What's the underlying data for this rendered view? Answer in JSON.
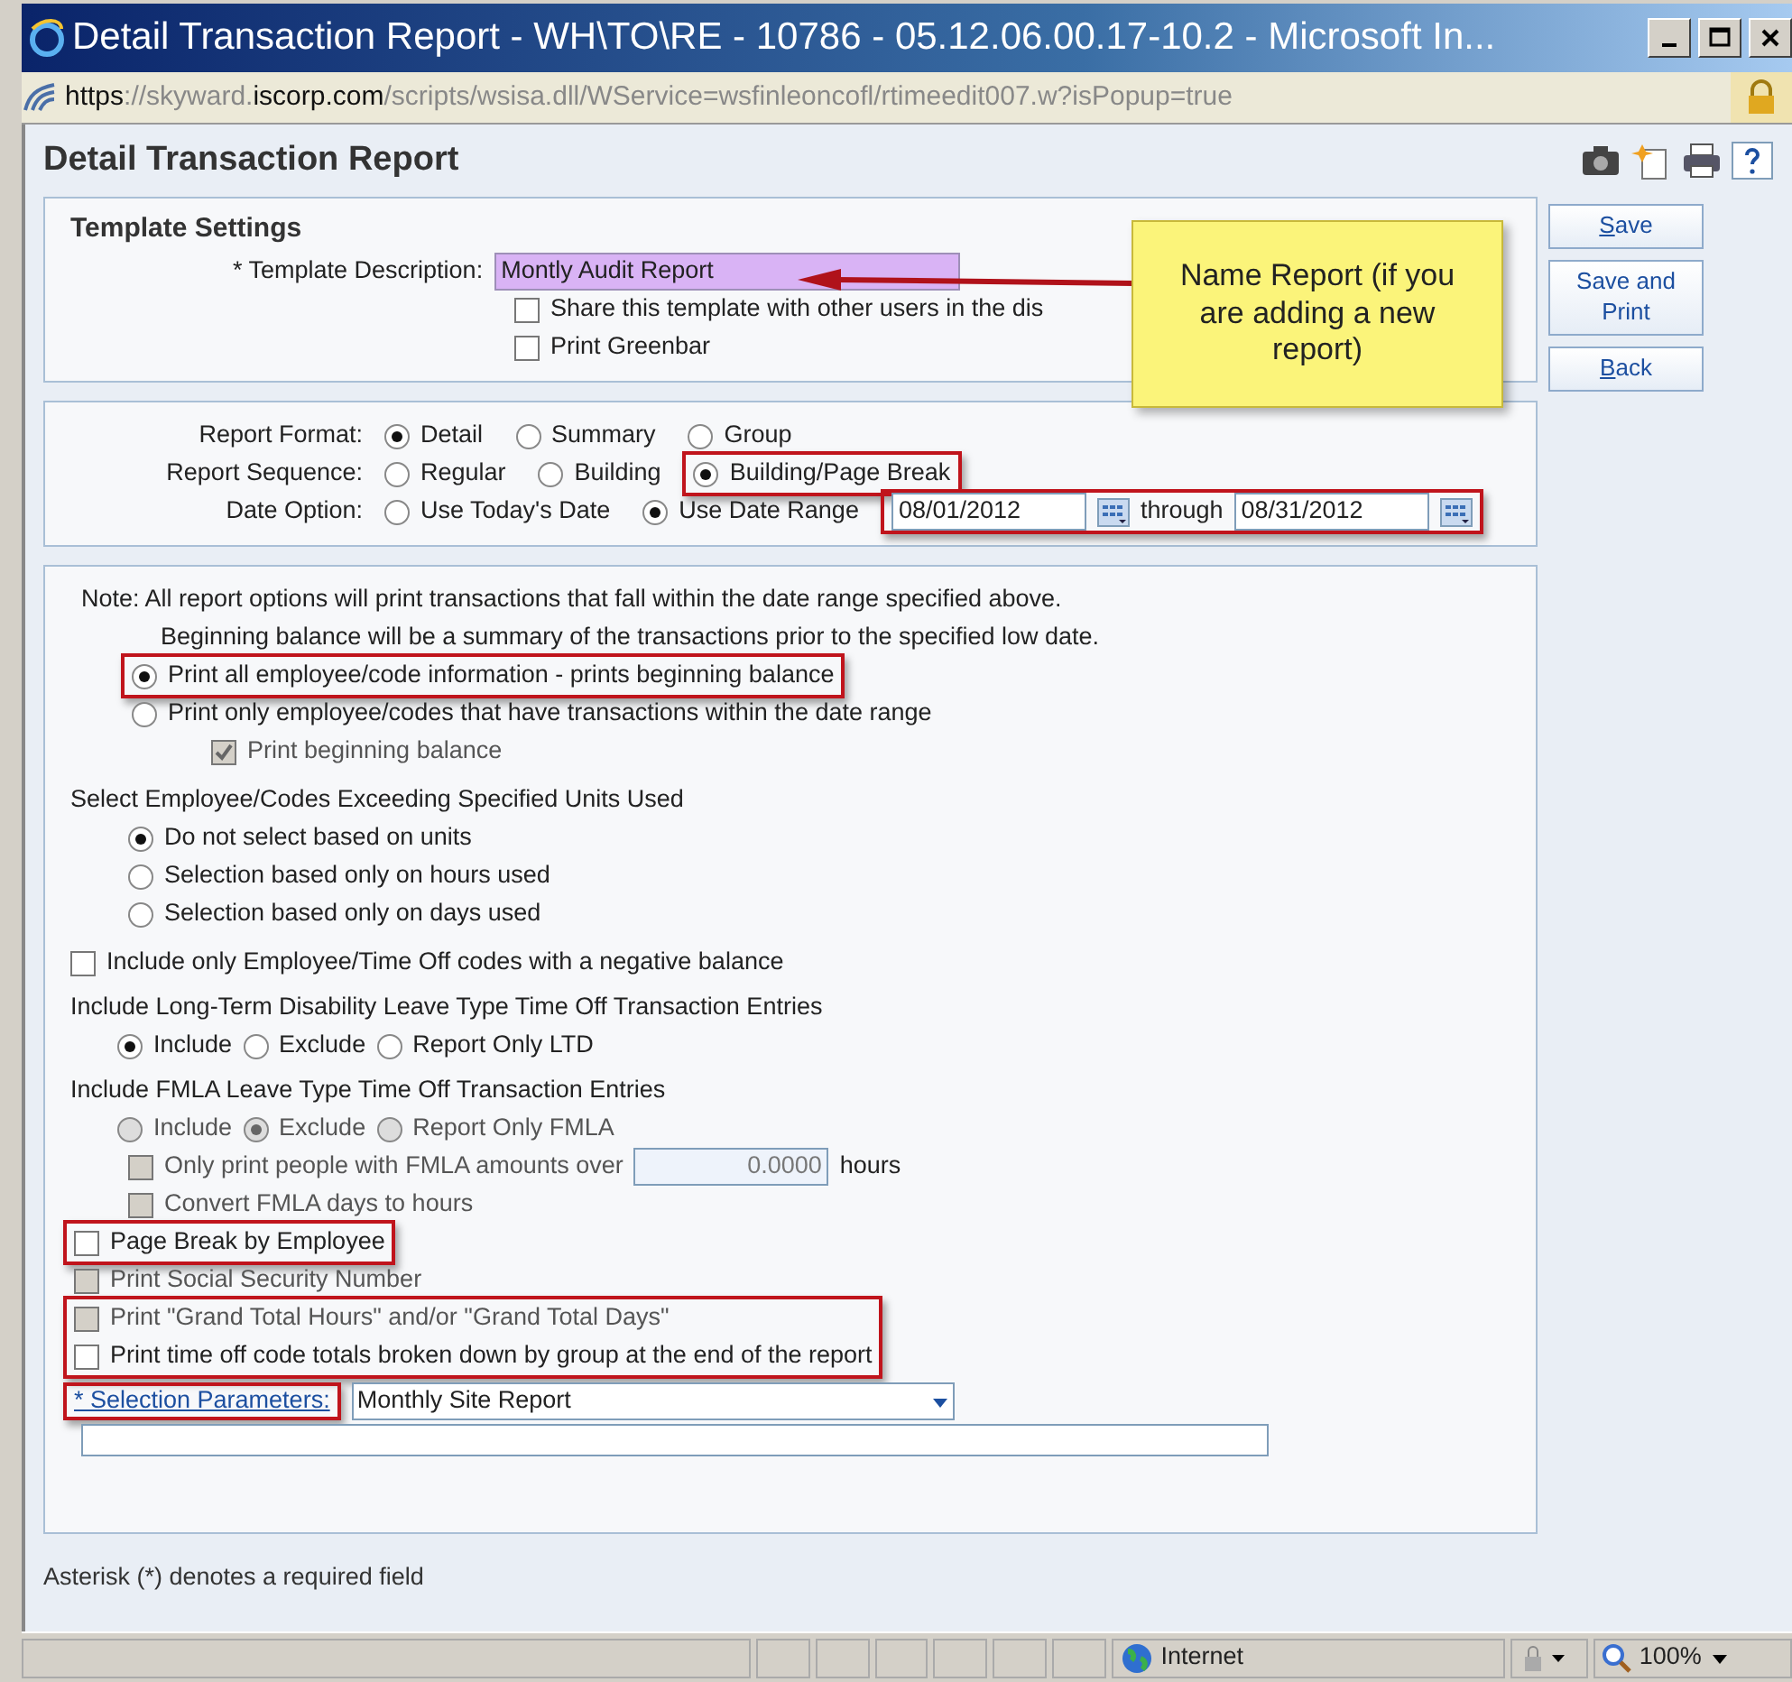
{
  "window": {
    "title": "Detail Transaction Report - WH\\TO\\RE - 10786 - 05.12.06.00.17-10.2 - Microsoft In..."
  },
  "address": {
    "parts": [
      {
        "text": "https",
        "strong": true
      },
      {
        "text": "://skyward.",
        "strong": false
      },
      {
        "text": "iscorp.com",
        "strong": true
      },
      {
        "text": "/scripts/wsisa.dll/WService=wsfinleoncofl/rtimeedit007.w?isPopup=true",
        "strong": false
      }
    ]
  },
  "page": {
    "title": "Detail Transaction Report"
  },
  "template_settings": {
    "heading": "Template Settings",
    "description_label": "* Template Description:",
    "description_value": "Montly Audit Report",
    "options": [
      {
        "label": "Share this template with other users in the dis",
        "checked": false
      },
      {
        "label": "Print Greenbar",
        "checked": false
      }
    ]
  },
  "callout": {
    "text": "Name Report (if you are adding a new report)"
  },
  "actions": [
    {
      "label": "Save",
      "access_key": true
    },
    {
      "label": "Save and Print",
      "access_key": false
    },
    {
      "label": "Back",
      "access_key": true
    }
  ],
  "format_rows": [
    {
      "label": "Report Format:",
      "options": [
        {
          "label": "Detail",
          "selected": true,
          "highlighted": false
        },
        {
          "label": "Summary",
          "selected": false,
          "highlighted": false
        },
        {
          "label": "Group",
          "selected": false,
          "highlighted": false
        }
      ]
    },
    {
      "label": "Report Sequence:",
      "options": [
        {
          "label": "Regular",
          "selected": false,
          "highlighted": false
        },
        {
          "label": "Building",
          "selected": false,
          "highlighted": false
        },
        {
          "label": "Building/Page Break",
          "selected": true,
          "highlighted": true
        }
      ]
    },
    {
      "label": "Date Option:",
      "options": [
        {
          "label": "Use Today's Date",
          "selected": false,
          "highlighted": false
        },
        {
          "label": "Use Date Range",
          "selected": true,
          "highlighted": false
        }
      ]
    }
  ],
  "date_range": {
    "from": "08/01/2012",
    "connector": "through",
    "to": "08/31/2012",
    "highlighted": true
  },
  "note": {
    "lines": [
      "Note: All report options will print transactions that fall within the date range specified above.",
      "Beginning balance will be a summary of the transactions prior to the specified low date."
    ]
  },
  "balance_options": [
    {
      "label": "Print all employee/code information - prints beginning balance",
      "selected": true,
      "highlighted": true
    },
    {
      "label": "Print only employee/codes that have transactions within the date range",
      "selected": false,
      "highlighted": false
    }
  ],
  "beginning_balance": {
    "label": "Print beginning balance",
    "checked": true,
    "disabled": true
  },
  "units": {
    "heading": "Select Employee/Codes Exceeding Specified Units Used",
    "options": [
      {
        "label": "Do not select based on units",
        "selected": true
      },
      {
        "label": "Selection based only on hours used",
        "selected": false
      },
      {
        "label": "Selection based only on days used",
        "selected": false
      }
    ]
  },
  "negative_balance": {
    "label": "Include only Employee/Time Off codes with a negative balance",
    "checked": false
  },
  "ltd": {
    "heading": "Include Long-Term Disability Leave Type Time Off Transaction Entries",
    "disabled": false,
    "options": [
      {
        "label": "Include",
        "selected": true
      },
      {
        "label": "Exclude",
        "selected": false
      },
      {
        "label": "Report Only LTD",
        "selected": false
      }
    ]
  },
  "fmla": {
    "heading": "Include FMLA Leave Type Time Off Transaction Entries",
    "disabled": true,
    "options": [
      {
        "label": "Include",
        "selected": false
      },
      {
        "label": "Exclude",
        "selected": true
      },
      {
        "label": "Report Only FMLA",
        "selected": false
      }
    ]
  },
  "fmla_amount": {
    "label": "Only print people with FMLA amounts over",
    "checked": false,
    "disabled": true,
    "value": "0.0000",
    "unit": "hours"
  },
  "fmla_convert": {
    "label": "Convert FMLA days to hours",
    "checked": false,
    "disabled": true
  },
  "checkbox_groups": [
    {
      "highlighted": true,
      "items": [
        {
          "label": "Page Break by Employee",
          "checked": false,
          "disabled": false
        }
      ]
    },
    {
      "highlighted": false,
      "items": [
        {
          "label": "Print Social Security Number",
          "checked": false,
          "disabled": true
        }
      ]
    },
    {
      "highlighted": true,
      "items": [
        {
          "label": "Print \"Grand Total Hours\" and/or \"Grand Total Days\"",
          "checked": false,
          "disabled": true
        },
        {
          "label": "Print time off code totals broken down by group at the end of the report",
          "checked": false,
          "disabled": false
        }
      ]
    }
  ],
  "selection": {
    "label": "* Selection Parameters:",
    "highlighted": true,
    "value": "Monthly Site Report"
  },
  "footnote": "Asterisk (*) denotes a required field",
  "status_bar": {
    "zone": "Internet",
    "zoom": "100%"
  }
}
